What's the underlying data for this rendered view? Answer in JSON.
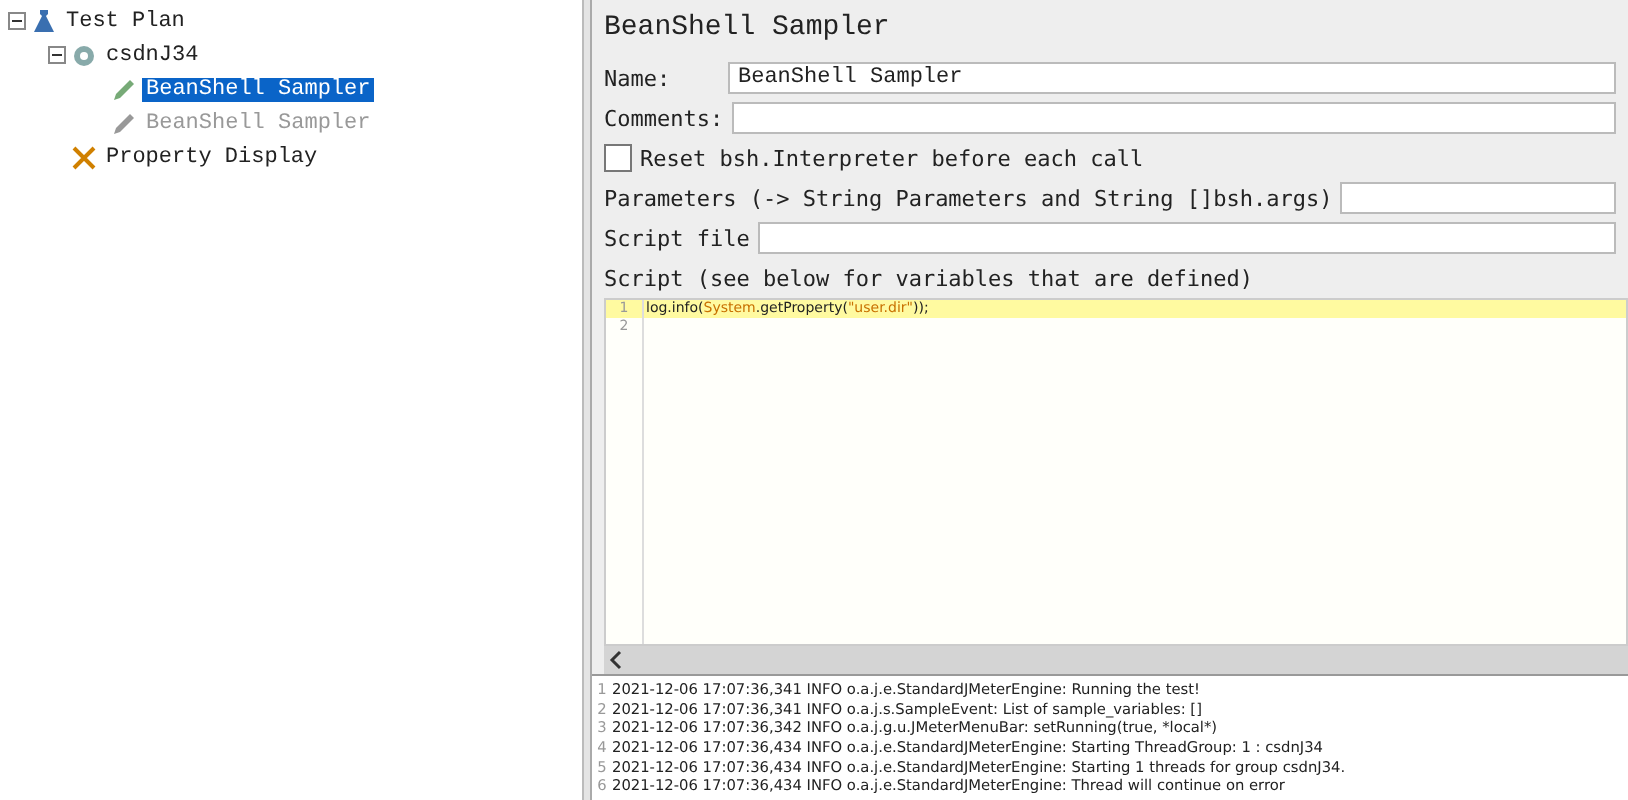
{
  "tree": [
    {
      "label": "Test Plan",
      "selected": false,
      "disabled": false,
      "expanded": true,
      "children": [
        {
          "label": "csdnJ34",
          "selected": false,
          "disabled": false,
          "expanded": true,
          "children": [
            {
              "label": "BeanShell Sampler",
              "selected": true,
              "disabled": false
            },
            {
              "label": "BeanShell Sampler",
              "selected": false,
              "disabled": true
            }
          ]
        },
        {
          "label": "Property Display",
          "selected": false,
          "disabled": false
        }
      ]
    }
  ],
  "panel": {
    "title": "BeanShell Sampler",
    "name": {
      "label": "Name:",
      "value": "BeanShell Sampler"
    },
    "comments": {
      "label": "Comments:"
    },
    "reset": {
      "label": "Reset bsh.Interpreter before each call",
      "checked": false
    },
    "parameters": {
      "label": "Parameters (-> String Parameters and String []bsh.args)"
    },
    "script_file": {
      "label": "Script file"
    },
    "script_label": "Script (see below for variables that are defined)",
    "script": [
      {
        "number": "1",
        "current": true,
        "tokens": [
          {
            "kind": "plain",
            "text": "log.info("
          },
          {
            "kind": "type",
            "text": "System"
          },
          {
            "kind": "plain",
            "text": ".getProperty("
          },
          {
            "kind": "string",
            "text": "\"user.dir\""
          },
          {
            "kind": "plain",
            "text": "));"
          }
        ]
      },
      {
        "number": "2",
        "current": false
      }
    ]
  },
  "log": [
    {
      "number": "1",
      "text": "2021-12-06 17:07:36,341 INFO o.a.j.e.StandardJMeterEngine: Running the test!"
    },
    {
      "number": "2",
      "text": "2021-12-06 17:07:36,341 INFO o.a.j.s.SampleEvent: List of sample_variables: []"
    },
    {
      "number": "3",
      "text": "2021-12-06 17:07:36,342 INFO o.a.j.g.u.JMeterMenuBar: setRunning(true, *local*)"
    },
    {
      "number": "4",
      "text": "2021-12-06 17:07:36,434 INFO o.a.j.e.StandardJMeterEngine: Starting ThreadGroup: 1 : csdnJ34"
    },
    {
      "number": "5",
      "text": "2021-12-06 17:07:36,434 INFO o.a.j.e.StandardJMeterEngine: Starting 1 threads for group csdnJ34."
    },
    {
      "number": "6",
      "text": "2021-12-06 17:07:36,434 INFO o.a.j.e.StandardJMeterEngine: Thread will continue on error"
    }
  ]
}
